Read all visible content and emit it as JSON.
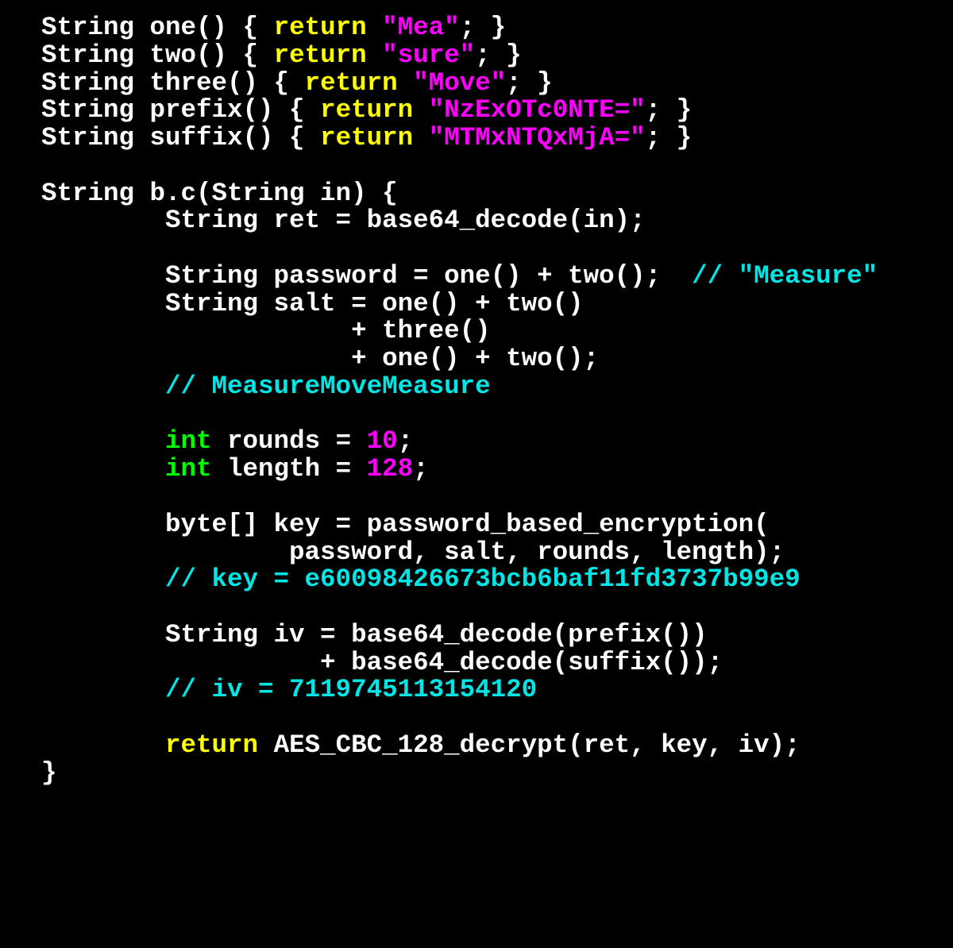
{
  "code": {
    "fn_one": {
      "sig": "String one() { ",
      "ret": "return",
      "sp": " ",
      "lit": "\"Mea\"",
      "tail": "; }"
    },
    "fn_two": {
      "sig": "String two() { ",
      "ret": "return",
      "sp": " ",
      "lit": "\"sure\"",
      "tail": "; }"
    },
    "fn_three": {
      "sig": "String three() { ",
      "ret": "return",
      "sp": " ",
      "lit": "\"Move\"",
      "tail": "; }"
    },
    "fn_prefix": {
      "sig": "String prefix() { ",
      "ret": "return",
      "sp": " ",
      "lit": "\"NzExOTc0NTE=\"",
      "tail": "; }"
    },
    "fn_suffix": {
      "sig": "String suffix() { ",
      "ret": "return",
      "sp": " ",
      "lit": "\"MTMxNTQxMjA=\"",
      "tail": "; }"
    },
    "bc_sig": "String b.c(String in) {",
    "l_ret": "        String ret = base64_decode(in);",
    "l_pwd": "        String password = one() + two();  ",
    "c_pwd": "// \"Measure\"",
    "l_salt1": "        String salt = one() + two()",
    "l_salt2": "                    + three()",
    "l_salt3": "                    + one() + two();",
    "c_salt": "        // MeasureMoveMeasure",
    "i8": "        ",
    "int": "int",
    "rounds_mid": " rounds = ",
    "rounds_val": "10",
    "length_mid": " length = ",
    "length_val": "128",
    "semi": ";",
    "l_key1": "        byte[] key = password_based_encryption(",
    "l_key2": "                password, salt, rounds, length);",
    "c_key": "        // key = e60098426673bcb6baf11fd3737b99e9",
    "l_iv1": "        String iv = base64_decode(prefix())",
    "l_iv2": "                  + base64_decode(suffix());",
    "c_iv": "        // iv = 7119745113154120",
    "ret_kw": "return",
    "ret_expr": " AES_CBC_128_decrypt(ret, key, iv);",
    "close": "}"
  }
}
